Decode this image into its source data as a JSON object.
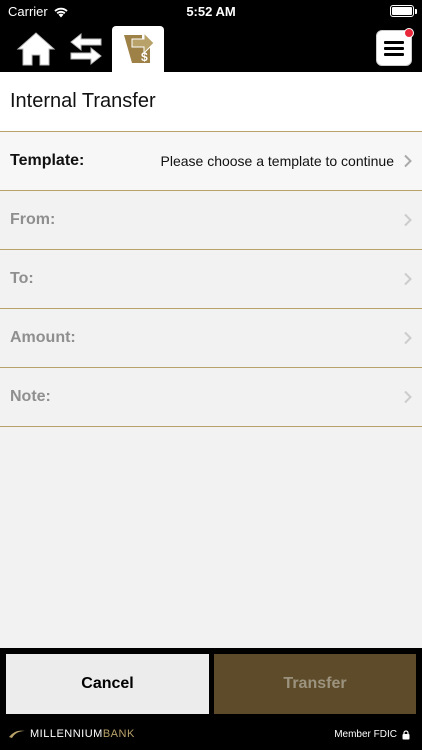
{
  "status": {
    "carrier": "Carrier",
    "time": "5:52 AM"
  },
  "nav": {
    "home_icon": "home-icon",
    "transfers_icon": "transfer-arrows-icon",
    "bill_icon": "bill-pay-icon",
    "menu_icon": "menu-icon",
    "has_notification": true
  },
  "page": {
    "title": "Internal Transfer"
  },
  "form": {
    "rows": [
      {
        "label": "Template:",
        "value": "Please choose a template to continue",
        "enabled": true
      },
      {
        "label": "From:",
        "value": "",
        "enabled": false
      },
      {
        "label": "To:",
        "value": "",
        "enabled": false
      },
      {
        "label": "Amount:",
        "value": "",
        "enabled": false
      },
      {
        "label": "Note:",
        "value": "",
        "enabled": false
      }
    ]
  },
  "actions": {
    "cancel": "Cancel",
    "transfer": "Transfer"
  },
  "brand": {
    "name_part1": "MILLENNIUM",
    "name_part2": "BANK",
    "fdic": "Member FDIC"
  },
  "colors": {
    "accent_gold": "#b8a269",
    "transfer_button": "#5e4b2a",
    "notification": "#e8283a"
  }
}
